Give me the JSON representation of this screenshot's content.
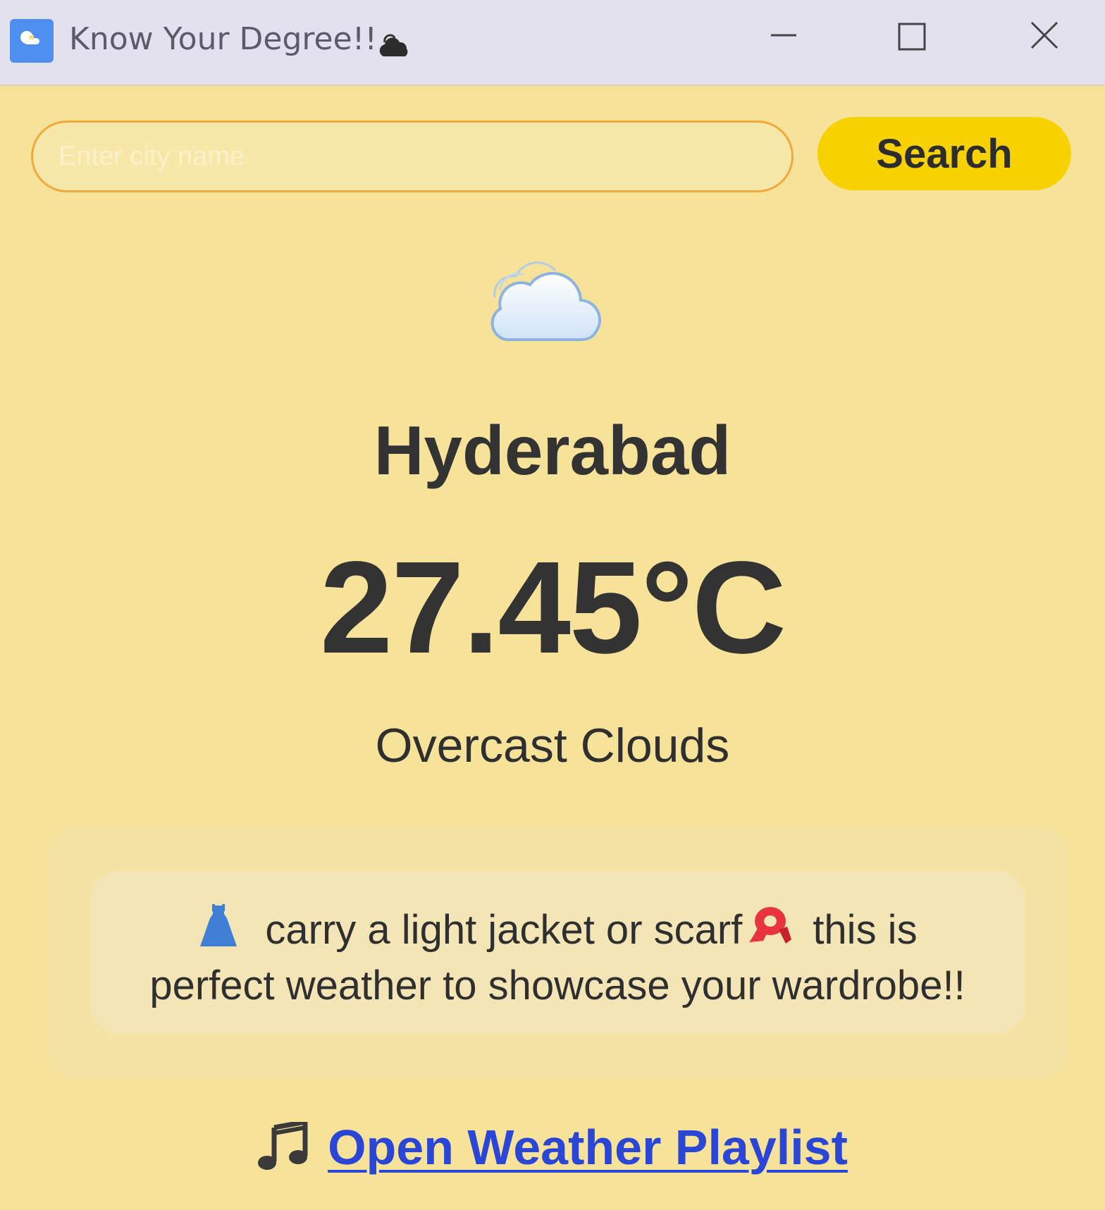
{
  "window": {
    "title": "Know Your Degree!!",
    "title_glyph": "cloud-emoji",
    "controls": [
      "minimize-icon",
      "maximize-icon",
      "close-icon"
    ]
  },
  "search": {
    "placeholder": "Enter city name",
    "value": "",
    "button_label": "Search"
  },
  "weather": {
    "icon": "overcast-cloud-icon",
    "city": "Hyderabad",
    "temperature": "27.45°C",
    "condition": "Overcast Clouds"
  },
  "advice": {
    "icon_start": "dress-icon",
    "line1_text": "carry a light jacket or scarf",
    "icon_mid": "scarf-icon",
    "line1_tail": "this is",
    "line2": "perfect weather to showcase your wardrobe!!"
  },
  "playlist": {
    "icon": "music-note-icon",
    "label": "Open Weather Playlist"
  },
  "colors": {
    "background": "#f7e29a",
    "titlebar": "#e4e1ef",
    "input_border": "#f2a83a",
    "button": "#f7d200",
    "text": "#333333",
    "link": "#2a46d6"
  }
}
